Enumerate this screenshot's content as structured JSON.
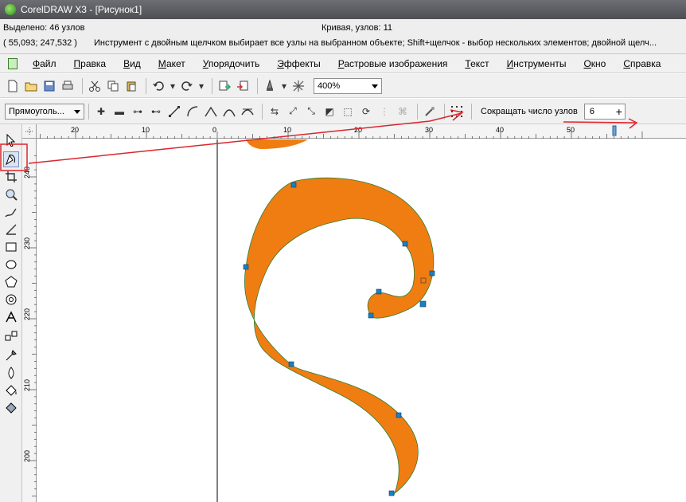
{
  "window": {
    "title": "CorelDRAW X3 - [Рисунок1]"
  },
  "status": {
    "selected": "Выделено: 46 узлов",
    "curve": "Кривая, узлов: 11",
    "coords": "( 55,093; 247,532 )",
    "hint": "Инструмент с двойным щелчком выбирает все узлы на выбранном объекте; Shift+щелчок - выбор нескольких элементов; двойной щелч..."
  },
  "menu": [
    {
      "label": "Файл",
      "key": "Ф",
      "rest": "айл"
    },
    {
      "label": "Правка",
      "key": "П",
      "rest": "равка"
    },
    {
      "label": "Вид",
      "key": "В",
      "rest": "ид"
    },
    {
      "label": "Макет",
      "key": "М",
      "rest": "акет"
    },
    {
      "label": "Упорядочить",
      "key": "У",
      "rest": "порядочить"
    },
    {
      "label": "Эффекты",
      "key": "Э",
      "rest": "ффекты"
    },
    {
      "label": "Растровые изображения",
      "key": "Р",
      "rest": "астровые изображения"
    },
    {
      "label": "Текст",
      "key": "Т",
      "rest": "екст"
    },
    {
      "label": "Инструменты",
      "key": "И",
      "rest": "нструменты"
    },
    {
      "label": "Окно",
      "key": "О",
      "rest": "кно"
    },
    {
      "label": "Справка",
      "key": "С",
      "rest": "правка"
    }
  ],
  "toolbar": {
    "zoom": "400%"
  },
  "property_bar": {
    "shape_select": "Прямоуголь...",
    "reduce_label": "Сокращать число узлов",
    "reduce_value": "6"
  },
  "rulers": {
    "top_labels": [
      "20",
      "10",
      "0",
      "10",
      "20",
      "30",
      "40",
      "50"
    ],
    "left_labels": [
      "240",
      "230",
      "220",
      "210",
      "200"
    ]
  },
  "colors": {
    "fill": "#f07d12",
    "node": "#1a7fc6",
    "annotation": "#d9262c"
  }
}
